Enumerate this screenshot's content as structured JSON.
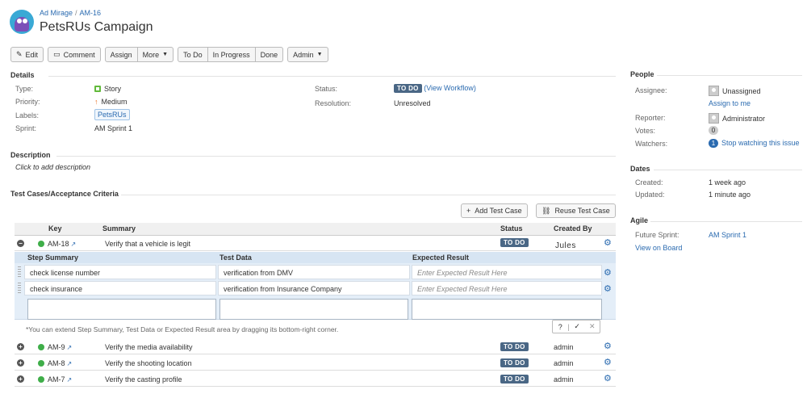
{
  "breadcrumb": {
    "project": "Ad Mirage",
    "issue_key": "AM-16"
  },
  "issue": {
    "title": "PetsRUs Campaign"
  },
  "toolbar": {
    "edit": "Edit",
    "comment": "Comment",
    "assign": "Assign",
    "more": "More",
    "todo": "To Do",
    "in_progress": "In Progress",
    "done": "Done",
    "admin": "Admin"
  },
  "details": {
    "heading": "Details",
    "type_label": "Type:",
    "type_value": "Story",
    "priority_label": "Priority:",
    "priority_value": "Medium",
    "labels_label": "Labels:",
    "labels_value": "PetsRUs",
    "sprint_label": "Sprint:",
    "sprint_value": "AM Sprint 1",
    "status_label": "Status:",
    "status_value": "TO DO",
    "view_workflow": "(View Workflow)",
    "resolution_label": "Resolution:",
    "resolution_value": "Unresolved"
  },
  "description": {
    "heading": "Description",
    "placeholder": "Click to add description"
  },
  "test_cases": {
    "heading": "Test Cases/Acceptance Criteria",
    "add_button": "Add Test Case",
    "reuse_button": "Reuse Test Case",
    "columns": {
      "key": "Key",
      "summary": "Summary",
      "status": "Status",
      "created_by": "Created By"
    },
    "expanded": {
      "key": "AM-18",
      "summary": "Verify that a vehicle is legit",
      "status": "TO DO",
      "created_by": "Jules"
    },
    "step_columns": {
      "step": "Step Summary",
      "data": "Test Data",
      "result": "Expected Result"
    },
    "steps": [
      {
        "step": "check license number",
        "data": "verification from DMV",
        "result": "Enter Expected Result Here"
      },
      {
        "step": "check insurance",
        "data": "verification from Insurance Company",
        "result": "Enter Expected Result Here"
      }
    ],
    "hint": "*You can extend Step Summary, Test Data or Expected Result area by dragging its bottom-right corner.",
    "rows": [
      {
        "key": "AM-9",
        "summary": "Verify the media availability",
        "status": "TO DO",
        "created_by": "admin"
      },
      {
        "key": "AM-8",
        "summary": "Verify the shooting location",
        "status": "TO DO",
        "created_by": "admin"
      },
      {
        "key": "AM-7",
        "summary": "Verify the casting profile",
        "status": "TO DO",
        "created_by": "admin"
      }
    ]
  },
  "people": {
    "heading": "People",
    "assignee_label": "Assignee:",
    "assignee_value": "Unassigned",
    "assign_to_me": "Assign to me",
    "reporter_label": "Reporter:",
    "reporter_value": "Administrator",
    "votes_label": "Votes:",
    "votes_value": "0",
    "watchers_label": "Watchers:",
    "watchers_count": "1",
    "watchers_link": "Stop watching this issue"
  },
  "dates": {
    "heading": "Dates",
    "created_label": "Created:",
    "created_value": "1 week ago",
    "updated_label": "Updated:",
    "updated_value": "1 minute ago"
  },
  "agile": {
    "heading": "Agile",
    "future_sprint_label": "Future Sprint:",
    "future_sprint_value": "AM Sprint 1",
    "view_on_board": "View on Board"
  }
}
